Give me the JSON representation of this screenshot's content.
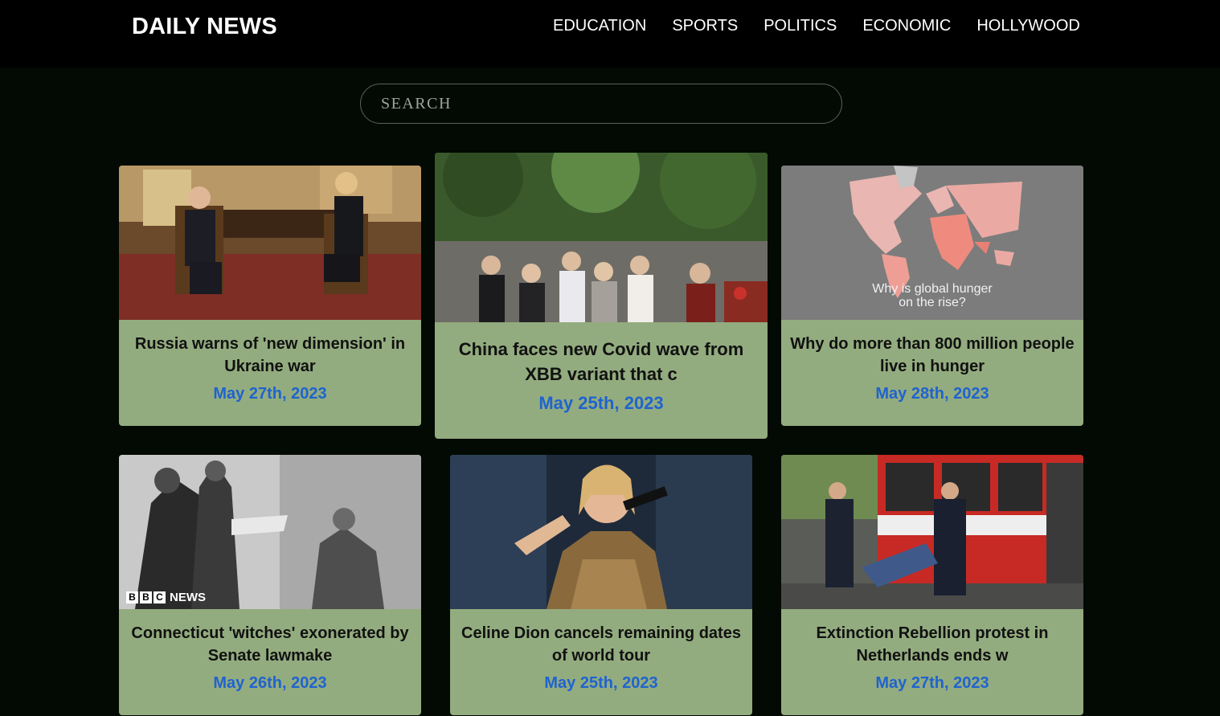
{
  "brand": "DAILY NEWS",
  "nav": [
    "EDUCATION",
    "SPORTS",
    "POLITICS",
    "ECONOMIC",
    "HOLLYWOOD"
  ],
  "search": {
    "placeholder": "SEARCH",
    "value": ""
  },
  "articles": [
    {
      "title": "Russia warns of 'new dimension' in Ukraine war",
      "date": "May 27th, 2023"
    },
    {
      "title": "China faces new Covid wave from XBB variant that c",
      "date": "May 25th, 2023"
    },
    {
      "title": "Why do more than 800 million people live in hunger",
      "date": "May 28th, 2023",
      "image_caption_line1": "Why is global hunger",
      "image_caption_line2": "on the rise?"
    },
    {
      "title": "Connecticut 'witches' exonerated by Senate lawmake",
      "date": "May 26th, 2023",
      "image_badge": "NEWS",
      "image_badge_letters": [
        "B",
        "B",
        "C"
      ]
    },
    {
      "title": "Celine Dion cancels remaining dates of world tour",
      "date": "May 25th, 2023"
    },
    {
      "title": "Extinction Rebellion protest in Netherlands ends w",
      "date": "May 27th, 2023"
    }
  ],
  "colors": {
    "background": "#020a03",
    "topbar": "#000000",
    "card": "#93ac7f",
    "date": "#1f63cf"
  }
}
